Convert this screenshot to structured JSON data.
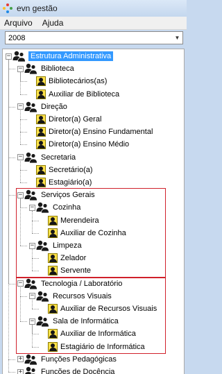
{
  "window": {
    "title": "evn gestão",
    "logo_colors": [
      "#e53935",
      "#fbc02d",
      "#43a047",
      "#1e88e5"
    ]
  },
  "menu": {
    "items": [
      "Arquivo",
      "Ajuda"
    ]
  },
  "year_select": {
    "value": "2008"
  },
  "tree": {
    "root": "Estrutura Administrativa",
    "groups": [
      {
        "label": "Biblioteca",
        "children": [
          "Bibliotecários(as)",
          "Auxiliar de Biblioteca"
        ]
      },
      {
        "label": "Direção",
        "children": [
          "Diretor(a) Geral",
          "Diretor(a) Ensino Fundamental",
          "Diretor(a) Ensino Médio"
        ]
      },
      {
        "label": "Secretaria",
        "children": [
          "Secretário(a)",
          "Estagiário(a)"
        ]
      },
      {
        "label": "Serviços Gerais",
        "subgroups": [
          {
            "label": "Cozinha",
            "children": [
              "Merendeira",
              "Auxiliar de Cozinha"
            ]
          },
          {
            "label": "Limpeza",
            "children": [
              "Zelador",
              "Servente"
            ]
          }
        ]
      },
      {
        "label": "Tecnologia / Laboratório",
        "subgroups": [
          {
            "label": "Recursos Visuais",
            "children": [
              "Auxiliar de Recursos Visuais"
            ]
          },
          {
            "label": "Sala de Informática",
            "children": [
              "Auxiliar de Informática",
              "Estagiário de Informática"
            ]
          }
        ]
      },
      {
        "label": "Funções Pedagógicas"
      },
      {
        "label": "Funções de Docência"
      }
    ]
  },
  "colors": {
    "selection": "#3399ff",
    "highlight_border": "#d0202a"
  }
}
